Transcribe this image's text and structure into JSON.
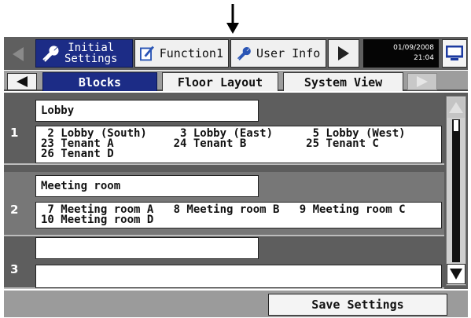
{
  "top_tabs": {
    "initial_line1": "Initial",
    "initial_line2": "Settings",
    "function": "Function1",
    "user_info": "User Info"
  },
  "datetime": {
    "date": "01/09/2008",
    "time": "21:04"
  },
  "sub_tabs": [
    "Blocks",
    "Floor Layout",
    "System View"
  ],
  "blocks": [
    {
      "number": "1",
      "name": "Lobby",
      "groups": [
        " 2 Lobby (South)     3 Lobby (East)      5 Lobby (West)",
        "23 Tenant A         24 Tenant B         25 Tenant C",
        "26 Tenant D"
      ]
    },
    {
      "number": "2",
      "name": "Meeting room",
      "groups": [
        " 7 Meeting room A   8 Meeting room B   9 Meeting room C",
        "10 Meeting room D"
      ]
    },
    {
      "number": "3",
      "name": "",
      "groups": []
    }
  ],
  "save_button": "Save Settings",
  "colors": {
    "selected_tab": "#1c2c86",
    "panel": "#5e5e5e"
  },
  "icons": [
    "wrench-icon",
    "pen-paper-icon",
    "monitor-icon",
    "arrow-down-icon"
  ]
}
